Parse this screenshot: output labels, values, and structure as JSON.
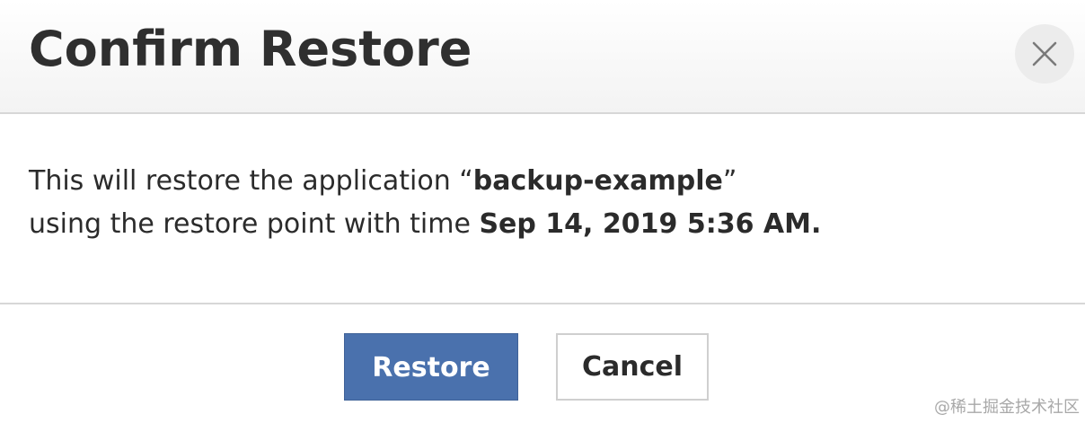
{
  "dialog": {
    "title": "Confirm Restore",
    "close_icon": "close-icon",
    "message": {
      "line1_prefix": "This will restore the application “",
      "app_name": "backup-example",
      "line1_suffix": "”",
      "line2_prefix": "using the restore point with time ",
      "restore_time": "Sep 14, 2019 5:36 AM."
    },
    "buttons": {
      "restore_label": "Restore",
      "cancel_label": "Cancel"
    }
  },
  "colors": {
    "primary_button": "#4a71ad",
    "header_bg": "#f3f3f3",
    "divider": "#d7d7d7"
  },
  "watermark": {
    "text": "@稀土掘金技术社区"
  }
}
